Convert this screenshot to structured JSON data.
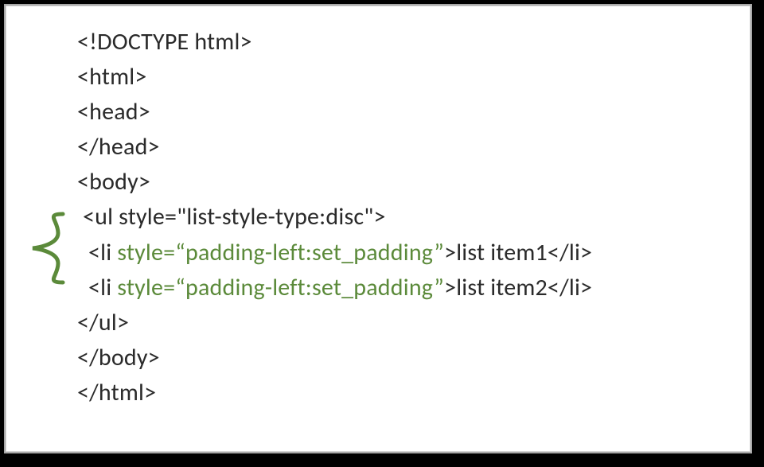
{
  "code": {
    "l1": "<!DOCTYPE html>",
    "l2": "<html>",
    "l3": "<head>",
    "l4": "</head>",
    "l5": "<body>",
    "l6": " <ul style=\"list-style-type:disc\">",
    "l7a": "  <li ",
    "l7b": "style=“padding-left:set_padding”",
    "l7c": ">list item1</li>",
    "l8a": "  <li ",
    "l8b": "style=“padding-left:set_padding”",
    "l8c": ">list item2</li>",
    "l9": "</ul>",
    "l10": "</body>",
    "l11": "</html>"
  }
}
